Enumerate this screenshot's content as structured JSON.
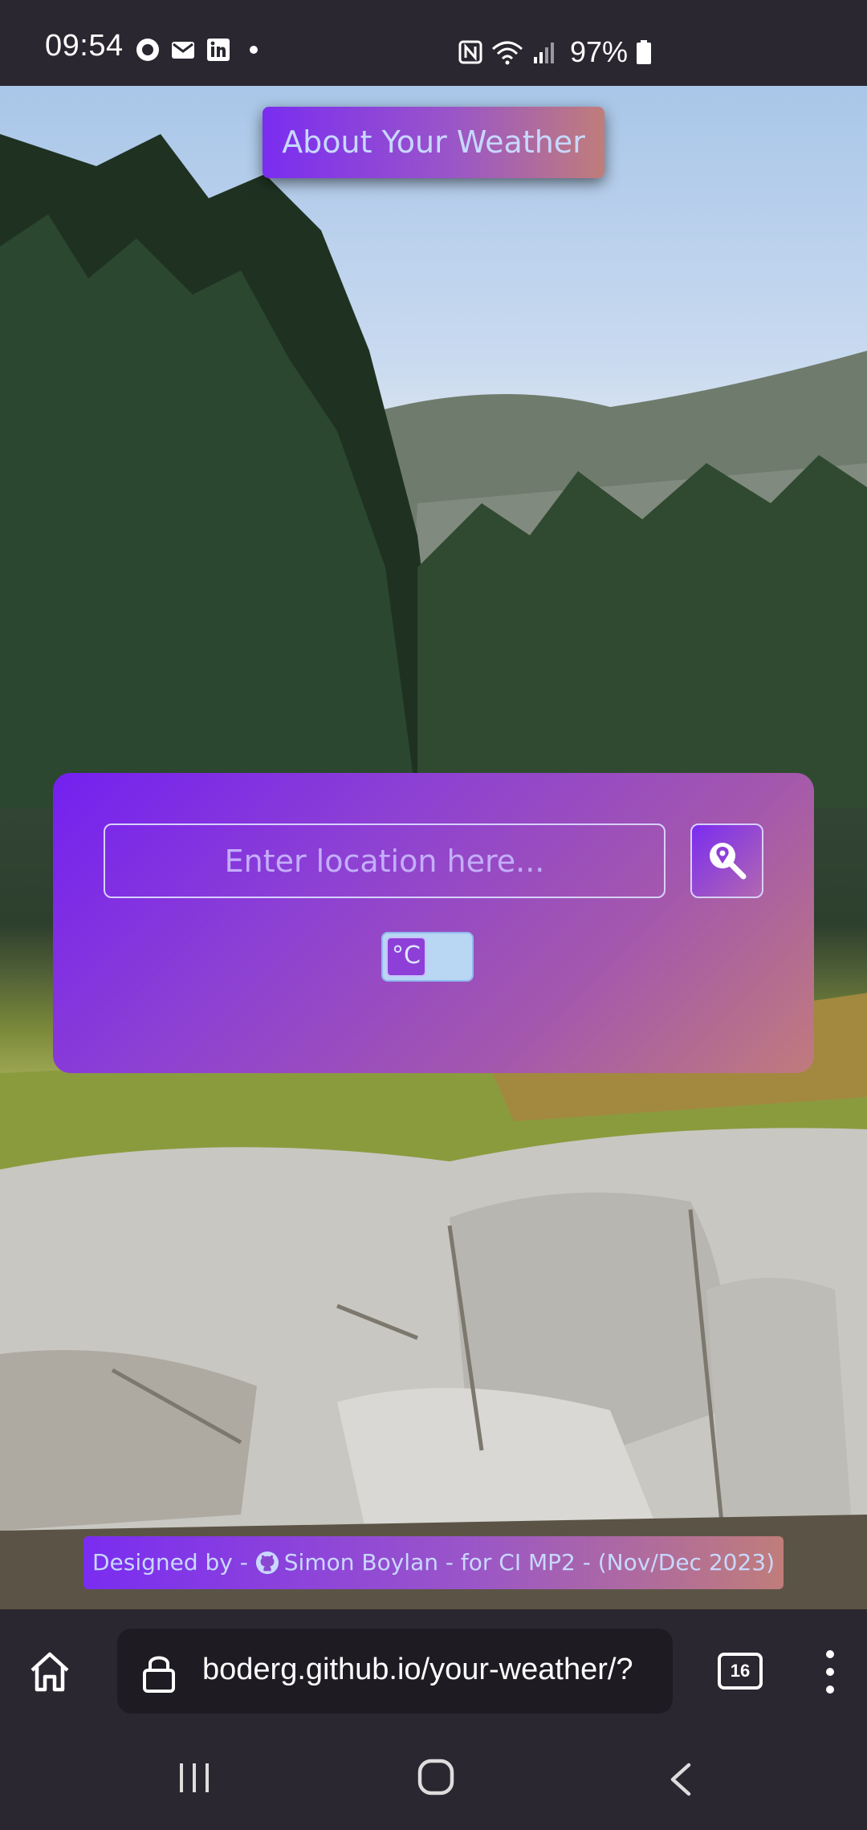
{
  "status_bar": {
    "time": "09:54",
    "battery": "97%",
    "left_icons": [
      "signal-app-icon",
      "mail-icon",
      "linkedin-icon",
      "dot-icon"
    ],
    "right_icons": [
      "nfc-icon",
      "wifi-icon",
      "cellular-signal-icon",
      "battery-icon"
    ]
  },
  "header": {
    "about_label": "About Your Weather"
  },
  "search": {
    "placeholder": "Enter location here...",
    "button_icon": "location-search-icon",
    "unit_label": "°C"
  },
  "footer": {
    "credit_prefix": "Designed by - ",
    "credit_icon": "github-icon",
    "credit_text": "Simon Boylan - for CI MP2 - (Nov/Dec 2023)"
  },
  "browser": {
    "url": "boderg.github.io/your-weather/?",
    "tab_count": "16"
  },
  "colors": {
    "gradient_start": "#7420f0",
    "gradient_end": "#c07b7c",
    "text_light": "#c8d8ff"
  }
}
